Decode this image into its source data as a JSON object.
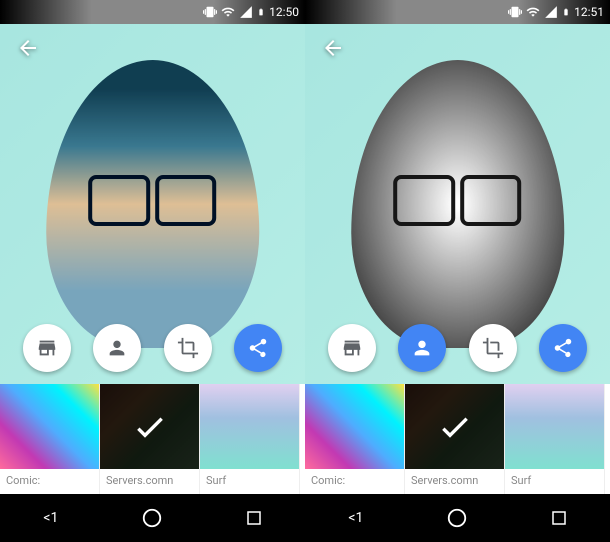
{
  "left": {
    "status": {
      "time": "12:50"
    },
    "actions": {
      "store": false,
      "person": false,
      "crop": false,
      "share": true
    },
    "filters": [
      {
        "id": "comic",
        "label": "Comic:",
        "selected": false
      },
      {
        "id": "servers",
        "label": "Servers.comn",
        "selected": true
      },
      {
        "id": "surf",
        "label": "Surf",
        "selected": false
      }
    ],
    "nav_label": "<1"
  },
  "right": {
    "status": {
      "time": "12:51"
    },
    "actions": {
      "store": false,
      "person": true,
      "crop": false,
      "share": true
    },
    "filters": [
      {
        "id": "comic",
        "label": "Comic:",
        "selected": false
      },
      {
        "id": "servers",
        "label": "Servers.comn",
        "selected": true
      },
      {
        "id": "surf",
        "label": "Surf",
        "selected": false
      }
    ],
    "nav_label": "<1"
  }
}
